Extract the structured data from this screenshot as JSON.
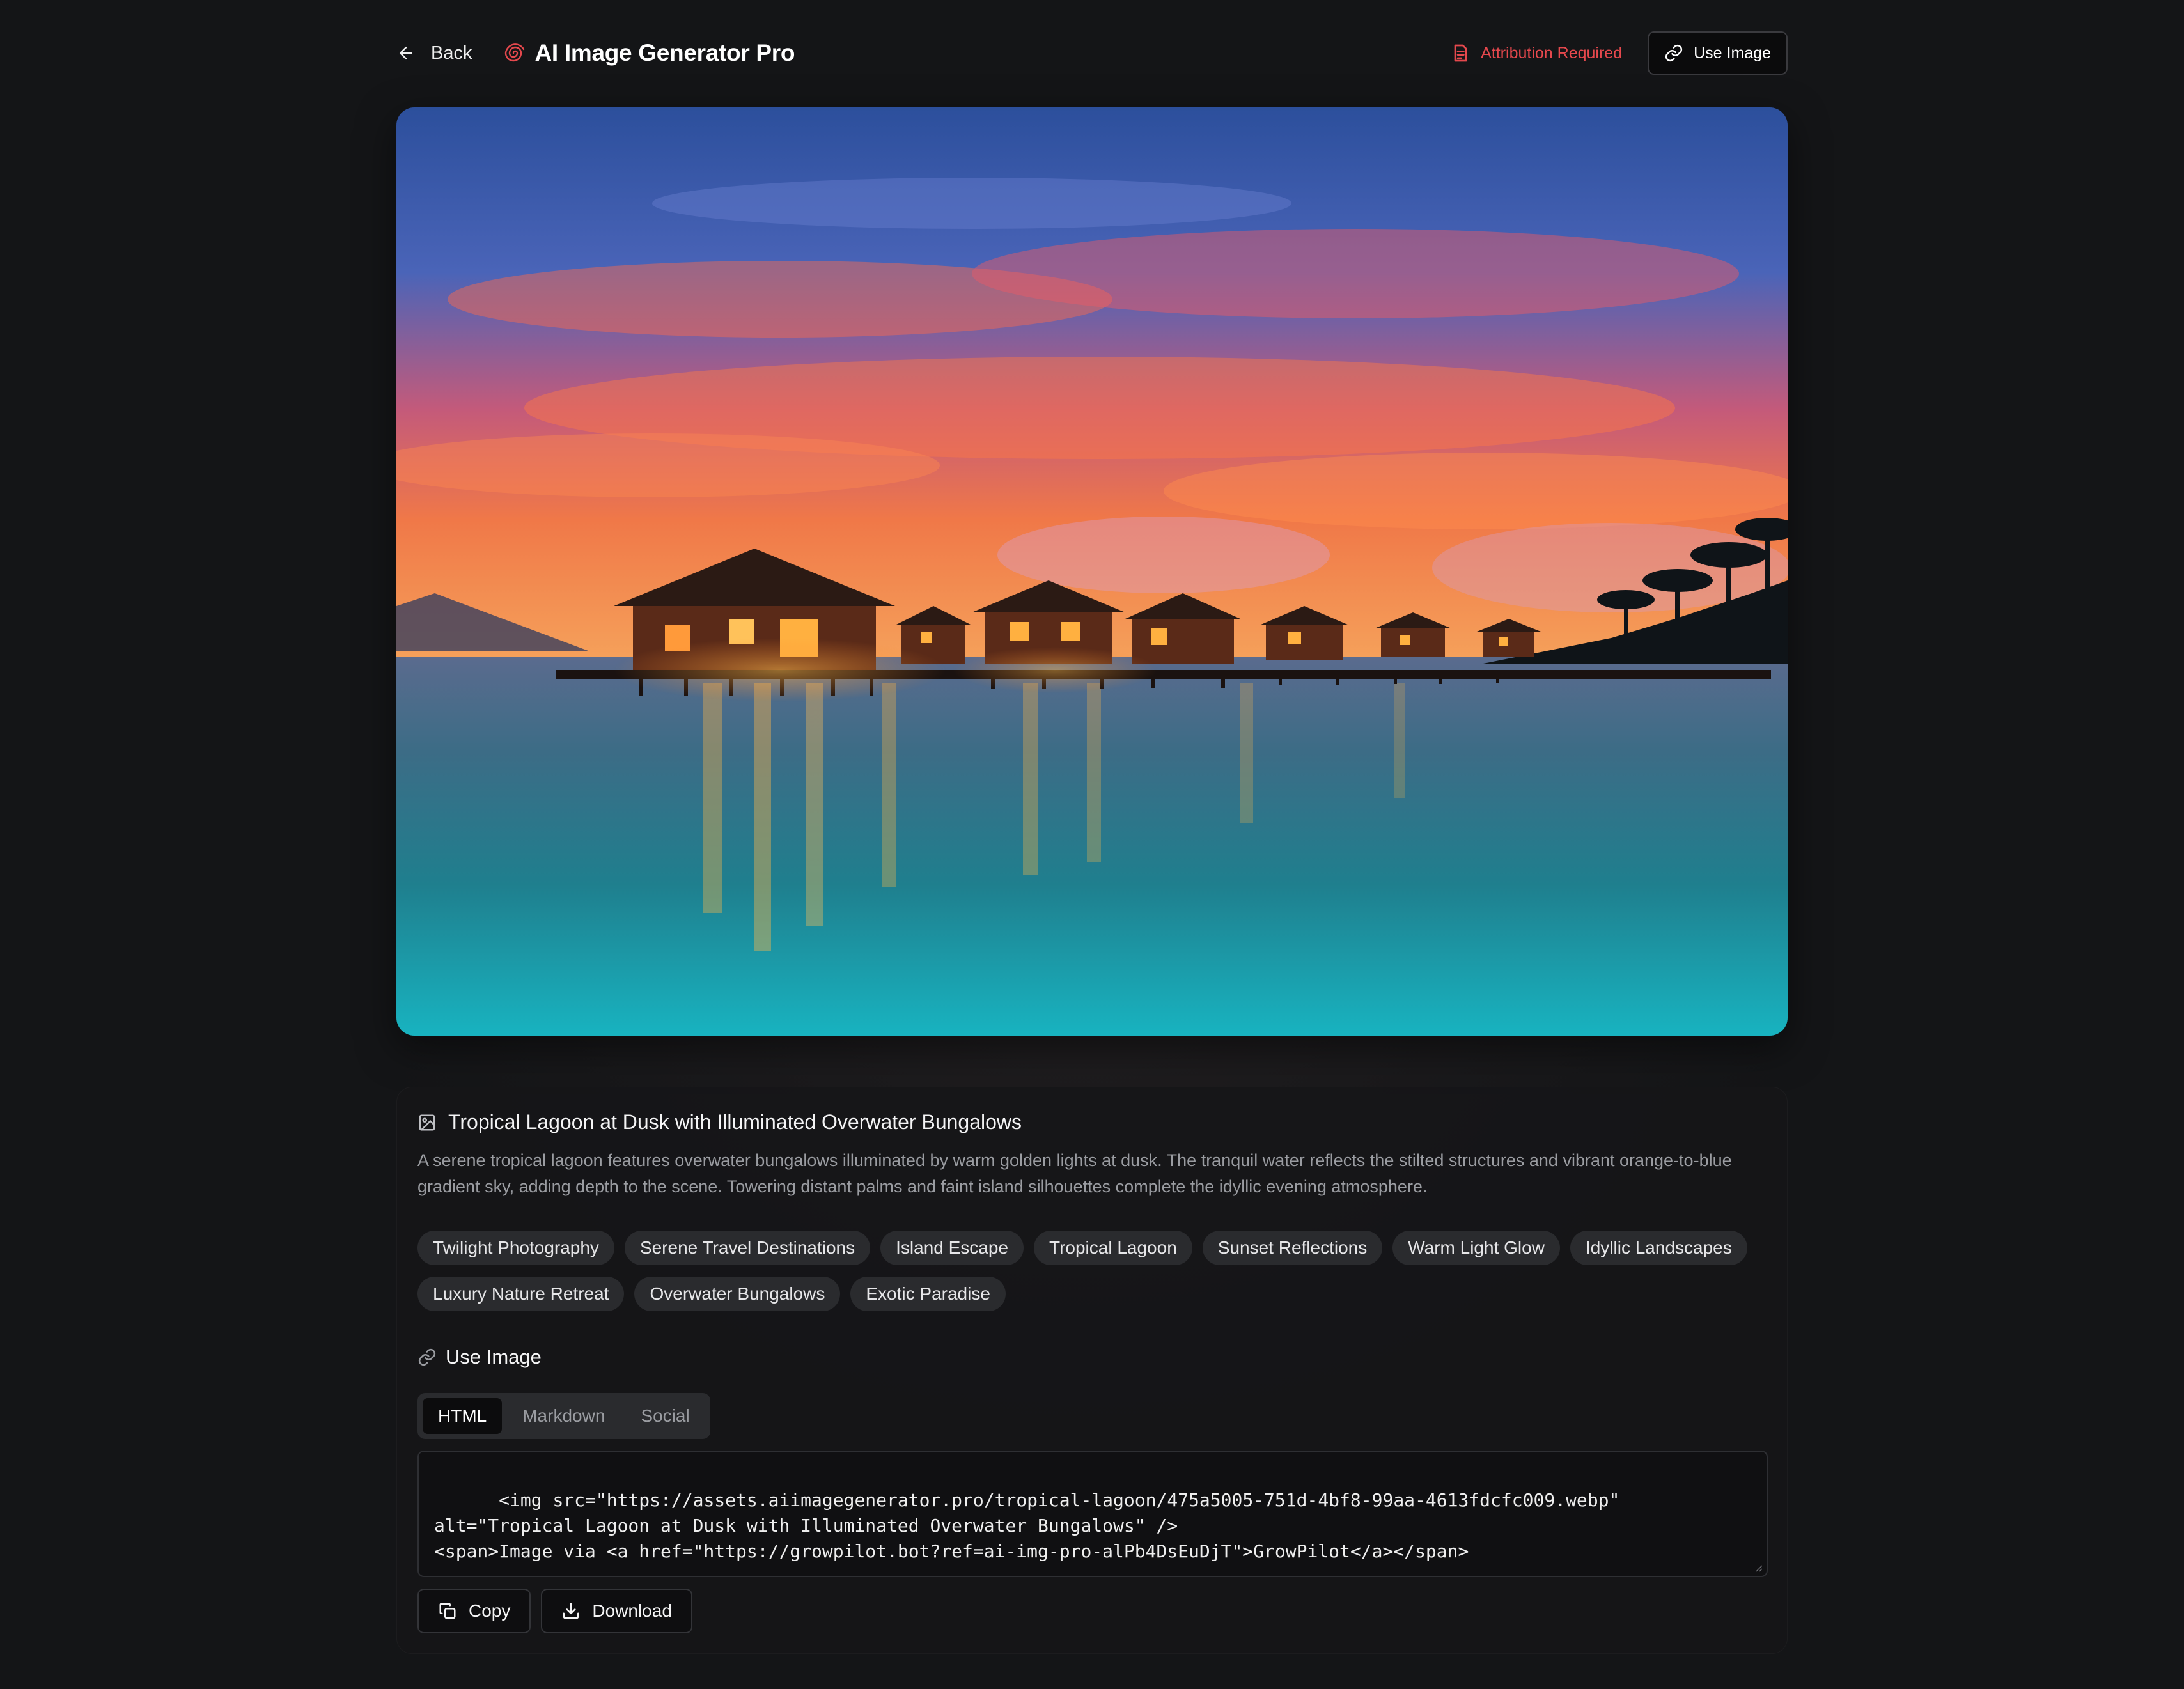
{
  "header": {
    "back_label": "Back",
    "app_title": "AI Image Generator Pro",
    "attribution_label": "Attribution Required",
    "use_image_label": "Use Image"
  },
  "image": {
    "title": "Tropical Lagoon at Dusk with Illuminated Overwater Bungalows",
    "description": "A serene tropical lagoon features overwater bungalows illuminated by warm golden lights at dusk. The tranquil water reflects the stilted structures and vibrant orange-to-blue gradient sky, adding depth to the scene. Towering distant palms and faint island silhouettes complete the idyllic evening atmosphere."
  },
  "tags": [
    "Twilight Photography",
    "Serene Travel Destinations",
    "Island Escape",
    "Tropical Lagoon",
    "Sunset Reflections",
    "Warm Light Glow",
    "Idyllic Landscapes",
    "Luxury Nature Retreat",
    "Overwater Bungalows",
    "Exotic Paradise"
  ],
  "use_image": {
    "section_title": "Use Image",
    "tabs": [
      "HTML",
      "Markdown",
      "Social"
    ],
    "active_tab": "HTML",
    "code": "<img src=\"https://assets.aiimagegenerator.pro/tropical-lagoon/475a5005-751d-4bf8-99aa-4613fdcfc009.webp\" alt=\"Tropical Lagoon at Dusk with Illuminated Overwater Bungalows\" />\n<span>Image via <a href=\"https://growpilot.bot?ref=ai-img-pro-alPb4DsEuDjT\">GrowPilot</a></span>",
    "copy_label": "Copy",
    "download_label": "Download"
  },
  "colors": {
    "accent_red": "#e5484d",
    "background": "#141517",
    "card": "#161618",
    "tag_bg": "#2a2b2e"
  },
  "icons": {
    "back": "arrow-left-icon",
    "logo": "spiral-logo-icon",
    "attribution": "document-icon",
    "use_image": "link-icon",
    "title": "image-icon",
    "copy": "copy-icon",
    "download": "download-icon"
  }
}
